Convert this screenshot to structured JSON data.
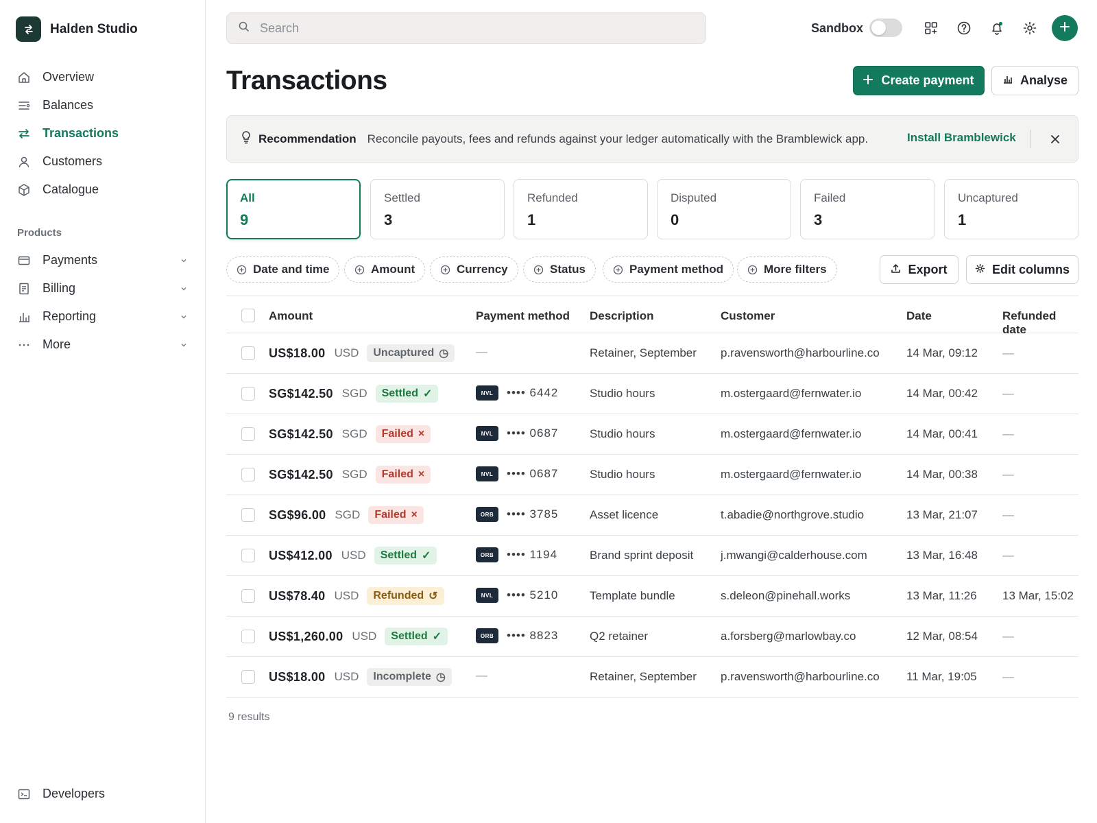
{
  "brand": {
    "name": "Halden Studio"
  },
  "nav": {
    "main": [
      {
        "label": "Overview",
        "icon": "home-icon"
      },
      {
        "label": "Balances",
        "icon": "balances-icon"
      },
      {
        "label": "Transactions",
        "icon": "transfer-icon",
        "active": true
      },
      {
        "label": "Customers",
        "icon": "user-icon"
      },
      {
        "label": "Catalogue",
        "icon": "box-icon"
      }
    ],
    "section_label": "Products",
    "products": [
      {
        "label": "Payments",
        "icon": "card-icon"
      },
      {
        "label": "Billing",
        "icon": "receipt-icon"
      },
      {
        "label": "Reporting",
        "icon": "bar-chart-icon"
      },
      {
        "label": "More",
        "icon": "more-icon"
      }
    ],
    "developers": "Developers"
  },
  "search": {
    "placeholder": "Search"
  },
  "topbar": {
    "sandbox_label": "Sandbox"
  },
  "page": {
    "title": "Transactions",
    "create_label": "Create payment",
    "analyse_label": "Analyse"
  },
  "banner": {
    "title": "Recommendation",
    "text": "Reconcile payouts, fees and refunds against your ledger automatically with the Bramblewick app.",
    "link": "Install Bramblewick"
  },
  "status_cards": [
    {
      "label": "All",
      "count": "9"
    },
    {
      "label": "Settled",
      "count": "3"
    },
    {
      "label": "Refunded",
      "count": "1"
    },
    {
      "label": "Disputed",
      "count": "0"
    },
    {
      "label": "Failed",
      "count": "3"
    },
    {
      "label": "Uncaptured",
      "count": "1"
    }
  ],
  "filters": [
    "Date and time",
    "Amount",
    "Currency",
    "Status",
    "Payment method",
    "More filters"
  ],
  "actions": {
    "export": "Export",
    "edit_columns": "Edit columns"
  },
  "table": {
    "headers": {
      "amount": "Amount",
      "payment_method": "Payment method",
      "description": "Description",
      "customer": "Customer",
      "date": "Date",
      "refunded_date": "Refunded date"
    },
    "rows": [
      {
        "amount": "US$18.00",
        "currency": "USD",
        "status": "Uncaptured",
        "status_icon": "◷",
        "pm_brand": "",
        "pm_last4": "—",
        "description": "Retainer, September",
        "customer": "p.ravensworth@harbourline.co",
        "date": "14 Mar, 09:12",
        "refunded": "—"
      },
      {
        "amount": "SG$142.50",
        "currency": "SGD",
        "status": "Settled",
        "status_icon": "✓",
        "pm_brand": "NVL",
        "pm_last4": "•••• 6442",
        "description": "Studio hours",
        "customer": "m.ostergaard@fernwater.io",
        "date": "14 Mar, 00:42",
        "refunded": "—"
      },
      {
        "amount": "SG$142.50",
        "currency": "SGD",
        "status": "Failed",
        "status_icon": "×",
        "pm_brand": "NVL",
        "pm_last4": "•••• 0687",
        "description": "Studio hours",
        "customer": "m.ostergaard@fernwater.io",
        "date": "14 Mar, 00:41",
        "refunded": "—"
      },
      {
        "amount": "SG$142.50",
        "currency": "SGD",
        "status": "Failed",
        "status_icon": "×",
        "pm_brand": "NVL",
        "pm_last4": "•••• 0687",
        "description": "Studio hours",
        "customer": "m.ostergaard@fernwater.io",
        "date": "14 Mar, 00:38",
        "refunded": "—"
      },
      {
        "amount": "SG$96.00",
        "currency": "SGD",
        "status": "Failed",
        "status_icon": "×",
        "pm_brand": "ORB",
        "pm_last4": "•••• 3785",
        "description": "Asset licence",
        "customer": "t.abadie@northgrove.studio",
        "date": "13 Mar, 21:07",
        "refunded": "—"
      },
      {
        "amount": "US$412.00",
        "currency": "USD",
        "status": "Settled",
        "status_icon": "✓",
        "pm_brand": "ORB",
        "pm_last4": "•••• 1194",
        "description": "Brand sprint deposit",
        "customer": "j.mwangi@calderhouse.com",
        "date": "13 Mar, 16:48",
        "refunded": "—"
      },
      {
        "amount": "US$78.40",
        "currency": "USD",
        "status": "Refunded",
        "status_icon": "↺",
        "pm_brand": "NVL",
        "pm_last4": "•••• 5210",
        "description": "Template bundle",
        "customer": "s.deleon@pinehall.works",
        "date": "13 Mar, 11:26",
        "refunded": "13 Mar, 15:02"
      },
      {
        "amount": "US$1,260.00",
        "currency": "USD",
        "status": "Settled",
        "status_icon": "✓",
        "pm_brand": "ORB",
        "pm_last4": "•••• 8823",
        "description": "Q2 retainer",
        "customer": "a.forsberg@marlowbay.co",
        "date": "12 Mar, 08:54",
        "refunded": "—"
      },
      {
        "amount": "US$18.00",
        "currency": "USD",
        "status": "Incomplete",
        "status_icon": "◷",
        "pm_brand": "",
        "pm_last4": "—",
        "description": "Retainer, September",
        "customer": "p.ravensworth@harbourline.co",
        "date": "11 Mar, 19:05",
        "refunded": "—"
      }
    ]
  },
  "results_text": "9 results",
  "colors": {
    "accent": "#137a5e",
    "brand_logo_bg": "#1c3a33"
  }
}
